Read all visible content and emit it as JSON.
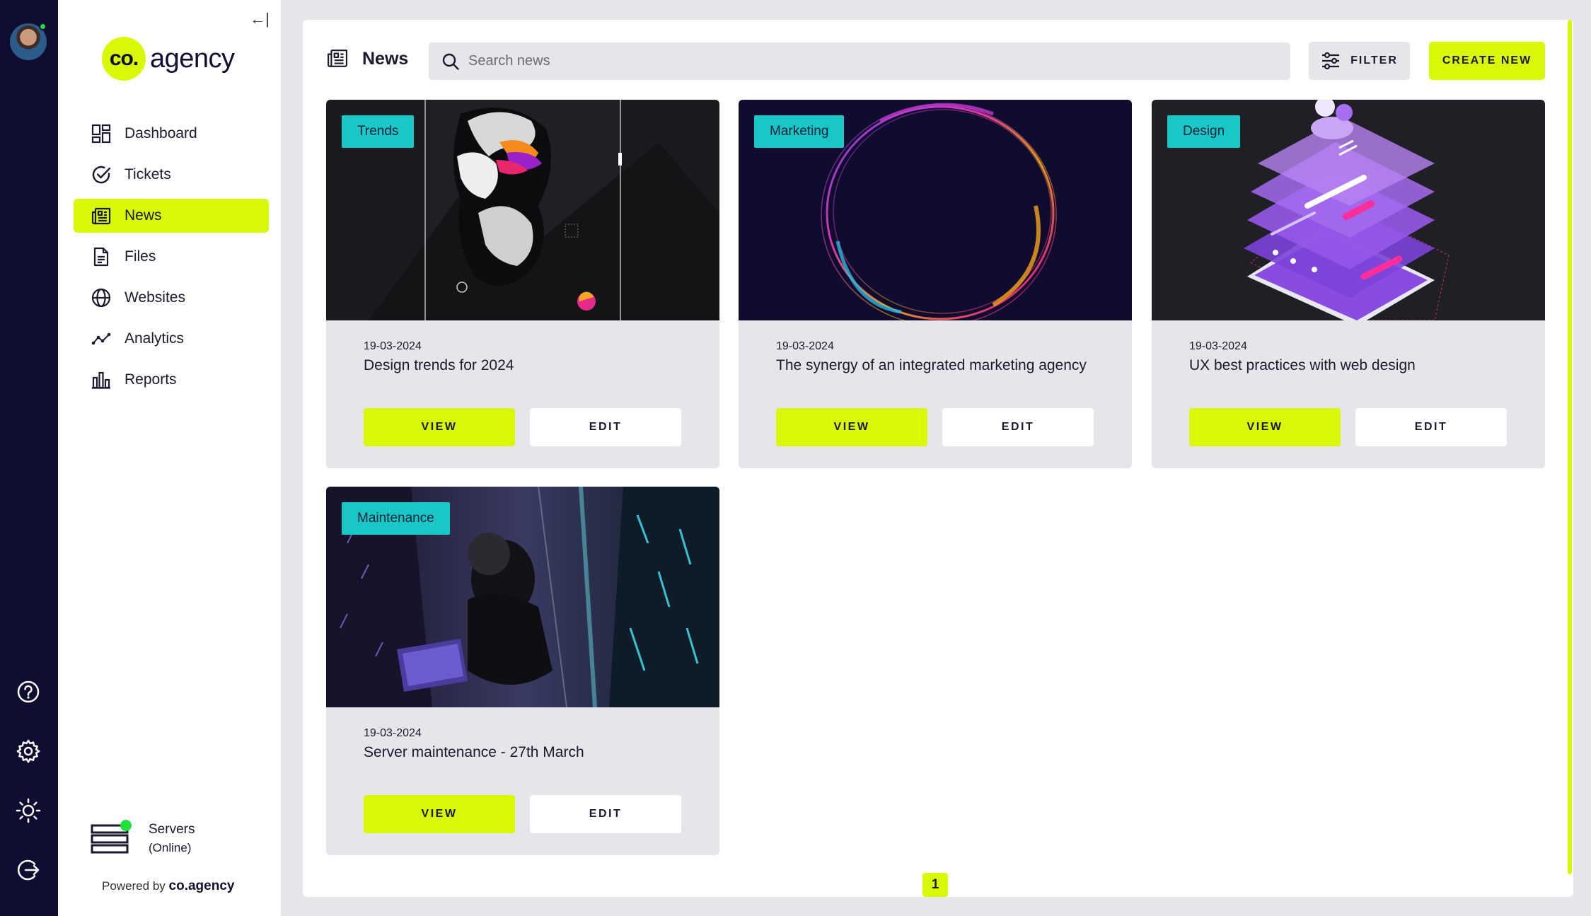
{
  "user": {
    "status": "online",
    "status_color": "#22e03a"
  },
  "brand": {
    "logo_mark": "co.",
    "logo_text": "agency",
    "accent": "#d9f808",
    "dark": "#100d33",
    "tag_color": "#18c7c6"
  },
  "rail": {
    "help_icon": "question-circle-icon",
    "settings_icon": "gear-icon",
    "theme_icon": "sun-icon",
    "logout_icon": "logout-icon"
  },
  "sidebar": {
    "collapse_label": "←|",
    "items": [
      {
        "label": "Dashboard",
        "icon": "dashboard-icon",
        "active": false
      },
      {
        "label": "Tickets",
        "icon": "check-circle-icon",
        "active": false
      },
      {
        "label": "News",
        "icon": "newspaper-icon",
        "active": true
      },
      {
        "label": "Files",
        "icon": "file-icon",
        "active": false
      },
      {
        "label": "Websites",
        "icon": "globe-icon",
        "active": false
      },
      {
        "label": "Analytics",
        "icon": "analytics-icon",
        "active": false
      },
      {
        "label": "Reports",
        "icon": "bar-chart-icon",
        "active": false
      }
    ],
    "servers": {
      "label": "Servers",
      "status": "(Online)"
    },
    "powered_by": "Powered by",
    "powered_brand": "co.agency"
  },
  "header": {
    "title": "News",
    "search_placeholder": "Search news",
    "filter_label": "FILTER",
    "create_label": "CREATE NEW"
  },
  "cards": [
    {
      "tag": "Trends",
      "date": "19-03-2024",
      "title": "Design trends for 2024",
      "view": "VIEW",
      "edit": "EDIT"
    },
    {
      "tag": "Marketing",
      "date": "19-03-2024",
      "title": "The synergy of an integrated marketing agency",
      "view": "VIEW",
      "edit": "EDIT"
    },
    {
      "tag": "Design",
      "date": "19-03-2024",
      "title": "UX best practices with web design",
      "view": "VIEW",
      "edit": "EDIT"
    },
    {
      "tag": "Maintenance",
      "date": "19-03-2024",
      "title": "Server maintenance - 27th March",
      "view": "VIEW",
      "edit": "EDIT"
    }
  ],
  "pagination": {
    "current": "1"
  }
}
